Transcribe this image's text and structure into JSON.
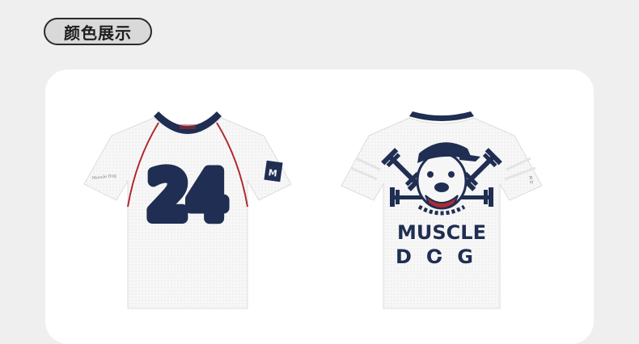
{
  "section": {
    "title": "颜色展示"
  },
  "front": {
    "number": "24",
    "chest_text": "Muscle\nDog Lab"
  },
  "back": {
    "line1": "MUSCLE",
    "line2": "DOG"
  },
  "colors": {
    "navy": "#1f2e52",
    "red": "#b02a2e",
    "shirt": "#f6f6f6",
    "background": "#efefef"
  },
  "icons": [
    "dog-head-icon",
    "dumbbell-icon",
    "sleeve-patch-icon"
  ]
}
